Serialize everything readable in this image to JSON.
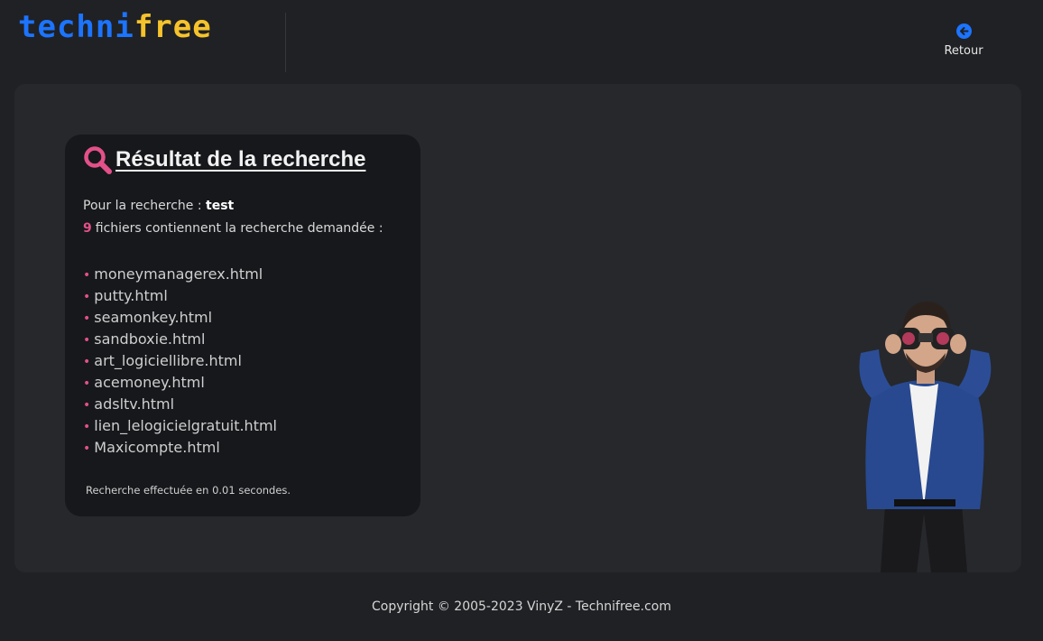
{
  "header": {
    "logo_part1": "techni",
    "logo_part2": "free",
    "back_label": "Retour",
    "back_icon": "arrow-left-circle-icon"
  },
  "colors": {
    "background": "#1f2124",
    "panel": "#26282c",
    "card": "#16181b",
    "accent_pink": "#e3508a",
    "logo_blue": "#1c74ff",
    "logo_yellow": "#f6c32c"
  },
  "search": {
    "title": "Résultat de la recherche",
    "icon": "search-icon",
    "query_prefix": "Pour la recherche :",
    "query": "test",
    "count": "9",
    "count_suffix": "fichiers contiennent la recherche demandée :",
    "results": [
      "moneymanagerex.html",
      "putty.html",
      "seamonkey.html",
      "sandboxie.html",
      "art_logiciellibre.html",
      "acemoney.html",
      "adsltv.html",
      "lien_lelogicielgratuit.html",
      "Maxicompte.html"
    ],
    "timing": "Recherche effectuée en 0.01 secondes."
  },
  "footer": {
    "copyright": "Copyright © 2005-2023 VinyZ - Technifree.com"
  }
}
